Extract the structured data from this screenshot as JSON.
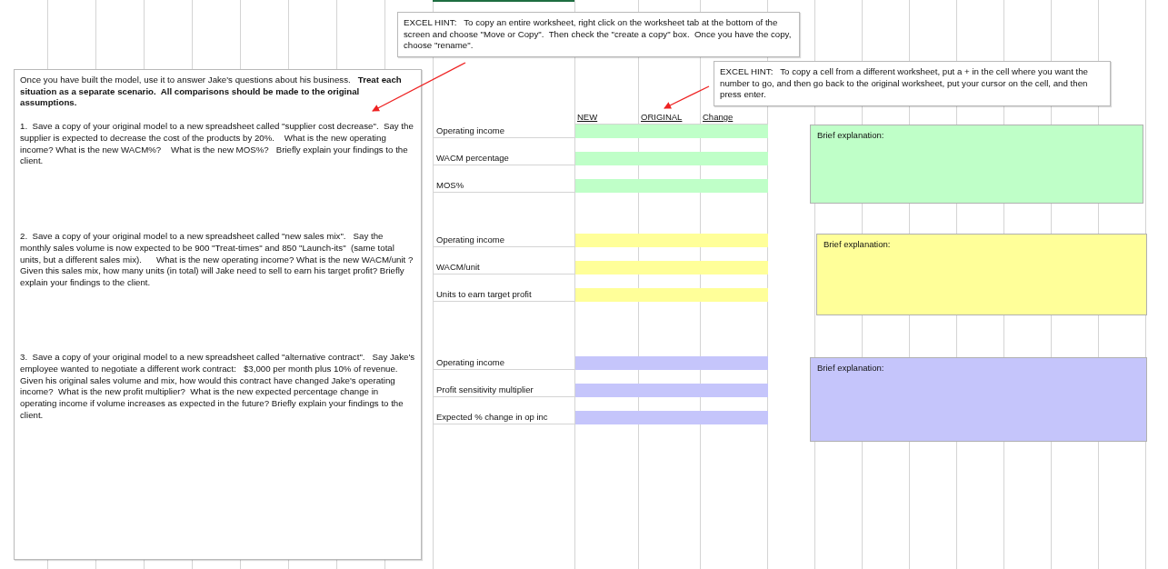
{
  "instructions": {
    "intro": "Once you have built the model, use it to answer Jake's questions about his business.   **Treat each situation as a separate scenario.  All comparisons should be made to the original assumptions.**",
    "questions": [
      "1.  Save a copy of your original model to a new spreadsheet called \"supplier cost decrease\".  Say the supplier is expected to decrease the cost of the products by 20%.    What is the new operating income? What is the new WACM%?    What is the new MOS%?   Briefly explain your findings to the client.",
      "2.  Save a copy of your original model to a new spreadsheet called \"new sales mix\".   Say the monthly sales volume is now expected to be 900 \"Treat-times\" and 850 \"Launch-its\"  (same total units, but a different sales mix).      What is the new operating income? What is the new WACM/unit ?  Given this sales mix, how many units (in total) will Jake need to sell to earn his target profit? Briefly explain your findings to the client.",
      "3.  Save a copy of your original model to a new spreadsheet called \"alternative contract\".   Say Jake's employee wanted to negotiate a different work contract:   $3,000 per month plus 10% of revenue.    Given his original sales volume and mix, how would this contract have changed Jake's operating income?  What is the new profit multiplier?  What is the new expected percentage change in operating income if volume increases as expected in the future? Briefly explain your findings to the client."
    ]
  },
  "hints": [
    "EXCEL HINT:   To copy an entire worksheet, right click on the worksheet tab at the bottom of the screen and choose \"Move or Copy\".  Then check the \"create a copy\" box.  Once you have the copy, choose \"rename\".",
    "EXCEL HINT:   To copy a cell from a different worksheet, put a + in the cell where you want the number to go, and then go back to the original worksheet, put your cursor on the cell, and then press enter."
  ],
  "column_headers": [
    "NEW",
    "ORIGINAL",
    "Change"
  ],
  "scenarios": [
    {
      "color": "#bfffc8",
      "rows": [
        "Operating income",
        "WACM percentage",
        "MOS%"
      ],
      "explanation_label": "Brief explanation:"
    },
    {
      "color": "#ffff99",
      "rows": [
        "Operating income",
        "WACM/unit",
        "Units to earn target profit"
      ],
      "explanation_label": "Brief explanation:"
    },
    {
      "color": "#c5c5fb",
      "rows": [
        "Operating income",
        "Profit sensitivity multiplier",
        "Expected % change in op inc"
      ],
      "explanation_label": "Brief explanation:"
    }
  ]
}
